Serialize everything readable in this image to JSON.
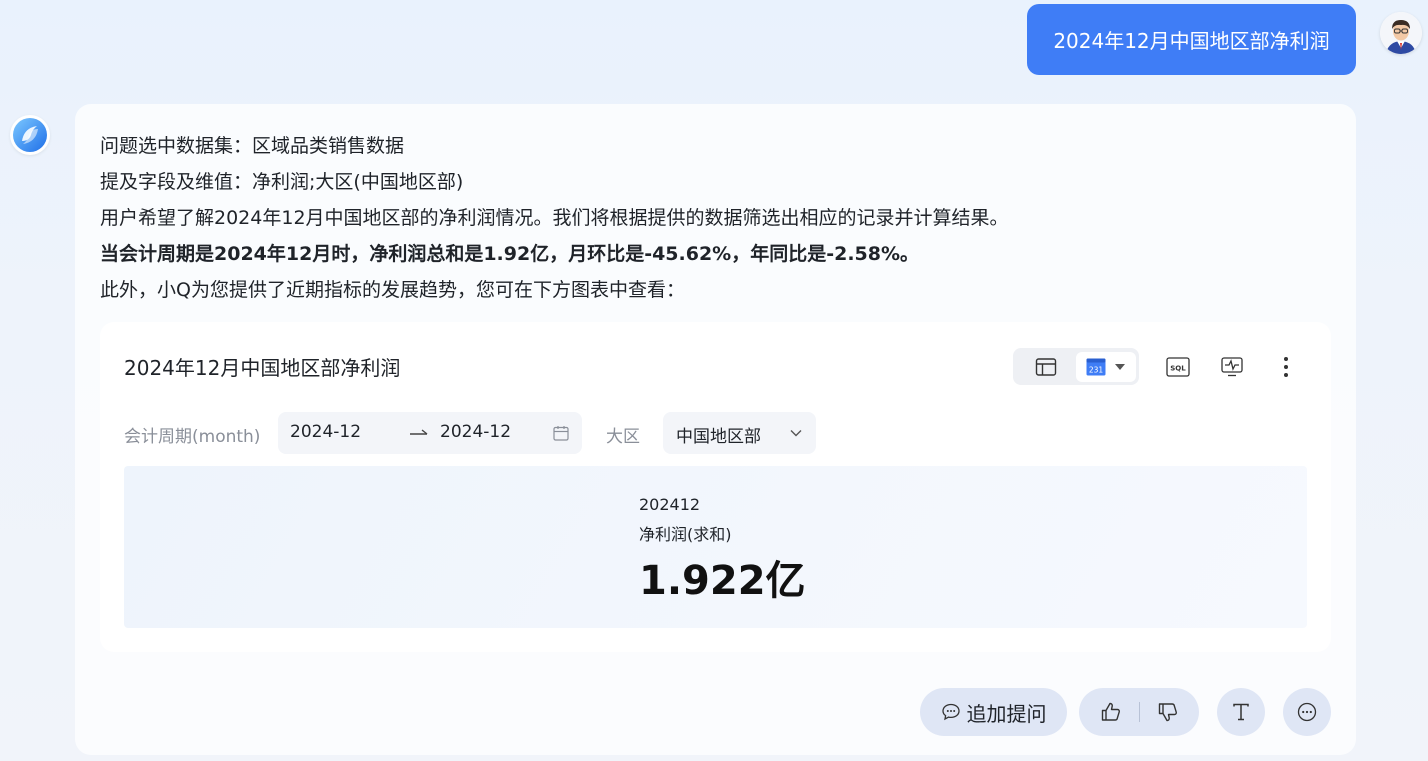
{
  "user_message": {
    "text": "2024年12月中国地区部净利润"
  },
  "answer": {
    "dataset_line": "问题选中数据集：区域品类销售数据",
    "fields_line": "提及字段及维值：净利润;大区(中国地区部)",
    "intent_line": "用户希望了解2024年12月中国地区部的净利润情况。我们将根据提供的数据筛选出相应的记录并计算结果。",
    "result_line": "当会计周期是2024年12月时，净利润总和是1.92亿，月环比是-45.62%，年同比是-2.58%。",
    "trend_line": "此外，小Q为您提供了近期指标的发展趋势，您可在下方图表中查看："
  },
  "chart_card": {
    "title": "2024年12月中国地区部净利润",
    "kpi_icon_text": "231",
    "sql_icon_text": "SQL",
    "filters": {
      "period_label": "会计周期(month)",
      "start": "2024-12",
      "end": "2024-12",
      "region_label": "大区",
      "region_value": "中国地区部"
    },
    "kpi": {
      "period": "202412",
      "metric": "净利润(求和)",
      "value": "1.922亿"
    }
  },
  "actions": {
    "followup_label": "追加提问"
  },
  "colors": {
    "accent": "#3f7df6",
    "pill_bg": "#dfe6f5",
    "background": "#eef3fb"
  }
}
